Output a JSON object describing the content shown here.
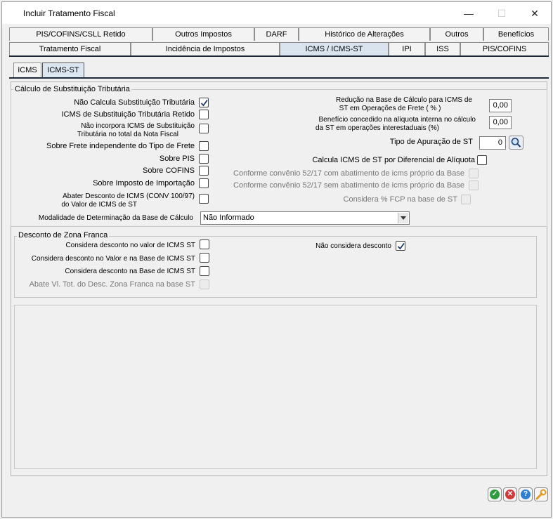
{
  "window": {
    "title": "Incluir Tratamento Fiscal",
    "minimize": "—",
    "maximize": "☐",
    "close": "✕"
  },
  "tabs_row1": [
    "PIS/COFINS/CSLL Retido",
    "Outros Impostos",
    "DARF",
    "Histórico de Alterações",
    "Outros",
    "Benefícios"
  ],
  "tabs_row2": [
    "Tratamento Fiscal",
    "Incidência de Impostos",
    "ICMS / ICMS-ST",
    "IPI",
    "ISS",
    "PIS/COFINS"
  ],
  "subtabs": [
    "ICMS",
    "ICMS-ST"
  ],
  "st_group": {
    "title": "Cálculo de Substituição Tributária",
    "left": [
      {
        "label": "Não Calcula Substituição Tributária",
        "checked": true
      },
      {
        "label": "ICMS de Substituição Tributária Retido",
        "checked": false
      },
      {
        "label1": "Não incorpora ICMS de Substituição",
        "label2": "Tributária no total da Nota Fiscal",
        "checked": false
      },
      {
        "label": "Sobre Frete independente do Tipo de Frete",
        "checked": false
      },
      {
        "label": "Sobre PIS",
        "checked": false
      },
      {
        "label": "Sobre COFINS",
        "checked": false
      },
      {
        "label": "Sobre Imposto de Importação",
        "checked": false
      },
      {
        "label1": "Abater Desconto de ICMS (CONV 100/97)",
        "label2": "do Valor de ICMS de ST",
        "checked": false
      }
    ],
    "modalidade_label": "Modalidade de Determinação da Base de Cálculo",
    "modalidade_value": "Não Informado",
    "reducao_label1": "Redução na Base de Cálculo para ICMS de",
    "reducao_label2": "ST em Operações de Frete ( % )",
    "reducao_value": "0,00",
    "beneficio_label1": "Benefício concedido na alíquota interna no cálculo",
    "beneficio_label2": "da ST em operações interestaduais (%)",
    "beneficio_value": "0,00",
    "apuracao_label": "Tipo de Apuração de ST",
    "apuracao_value": "0",
    "diferencial_label": "Calcula ICMS de ST por Diferencial de Alíquota",
    "conv_com_label": "Conforme convênio 52/17 com abatimento de icms próprio da Base",
    "conv_sem_label": "Conforme convênio 52/17 sem abatimento de icms próprio da Base",
    "fcp_label": "Considera % FCP na base de ST"
  },
  "zf_group": {
    "title": "Desconto de Zona Franca",
    "items": [
      {
        "label": "Considera desconto no valor de ICMS ST",
        "checked": false,
        "disabled": false
      },
      {
        "label": "Considera desconto no Valor e na Base de ICMS ST",
        "checked": false,
        "disabled": false
      },
      {
        "label": "Considera desconto na Base de ICMS ST",
        "checked": false,
        "disabled": false
      },
      {
        "label": "Abate Vl. Tot. do Desc. Zona Franca na base ST",
        "checked": false,
        "disabled": true
      }
    ],
    "nao_considera_label": "Não considera desconto",
    "nao_considera_checked": true
  },
  "buttons": [
    {
      "name": "confirm-button",
      "icon": "check-icon",
      "glyph": "✓",
      "color": "#2e9b3c"
    },
    {
      "name": "cancel-button",
      "icon": "cancel-icon",
      "glyph": "✕",
      "color": "#d23a3a"
    },
    {
      "name": "help-button",
      "icon": "help-icon",
      "glyph": "?",
      "color": "#2f7fd1"
    },
    {
      "name": "tools-button",
      "icon": "wrench-icon",
      "glyph": "",
      "color": "#e49a22"
    }
  ]
}
